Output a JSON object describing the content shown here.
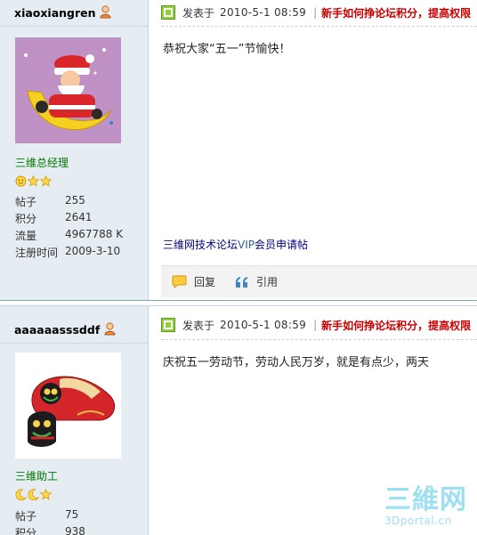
{
  "posts": [
    {
      "user": {
        "name": "xiaoxiangren",
        "group": "三维总经理",
        "stars": [
          "sun",
          "star",
          "star"
        ],
        "stats": [
          {
            "label": "帖子",
            "value": "255"
          },
          {
            "label": "积分",
            "value": "2641"
          },
          {
            "label": "流量",
            "value": "4967788 K"
          },
          {
            "label": "注册时间",
            "value": "2009-3-10"
          }
        ]
      },
      "header": {
        "posted_label": "发表于",
        "date": "2010-5-1 08:59",
        "separator": "|",
        "notice": "新手如何挣论坛积分，提高权限"
      },
      "message": "恭祝大家“五一”节愉快！",
      "vip_link": {
        "prefix": "三维网技术论坛",
        "vip": "VIP",
        "suffix": "会员申请帖"
      },
      "actions": {
        "reply": "回复",
        "quote": "引用"
      }
    },
    {
      "user": {
        "name": "aaaaaasssddf",
        "group": "三维助工",
        "stars": [
          "moon",
          "moon",
          "star"
        ],
        "stats": [
          {
            "label": "帖子",
            "value": "75"
          },
          {
            "label": "积分",
            "value": "938"
          }
        ]
      },
      "header": {
        "posted_label": "发表于",
        "date": "2010-5-1 08:59",
        "separator": "|",
        "notice": "新手如何挣论坛积分，提高权限"
      },
      "message": "庆祝五一劳动节，劳动人民万岁，就是有点少，两天"
    }
  ],
  "watermark": {
    "big": "三維网",
    "small": "3Dportal.cn"
  },
  "colors": {
    "sidebar_bg": "#e5edf2",
    "group_green": "#007700",
    "notice_red": "#cc0000",
    "link_navy": "#000080"
  },
  "icons": [
    "user-status-icon",
    "post-green-icon",
    "reply-icon",
    "quote-icon",
    "sun-icon",
    "moon-icon",
    "star-icon"
  ]
}
